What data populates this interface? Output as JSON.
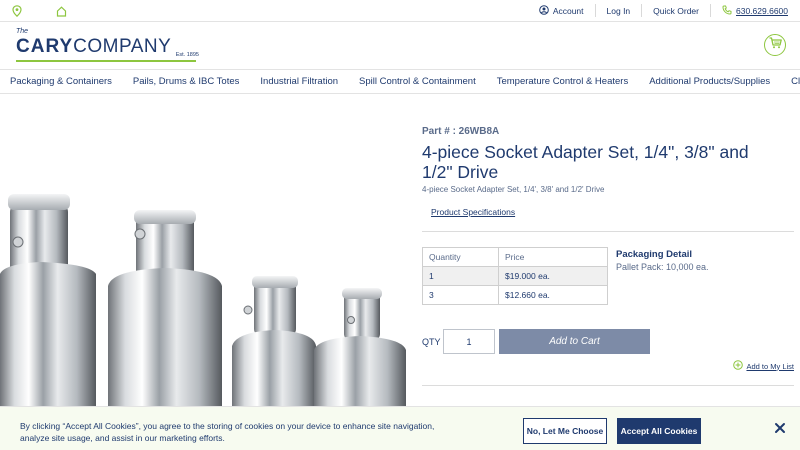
{
  "utility": {
    "account": "Account",
    "login": "Log In",
    "quick_order": "Quick Order",
    "phone": "630.629.6600"
  },
  "logo": {
    "the": "The",
    "cary": "CARY",
    "company": "COMPANY",
    "est": "Est. 1895"
  },
  "nav": {
    "items": [
      "Packaging & Containers",
      "Pails, Drums & IBC Totes",
      "Industrial Filtration",
      "Spill Control & Containment",
      "Temperature Control & Heaters",
      "Additional Products/Supplies",
      "Clearance"
    ]
  },
  "product": {
    "part": "Part # : 26WB8A",
    "title": "4-piece Socket Adapter Set, 1/4\", 3/8\" and 1/2\" Drive",
    "subtitle": "4-piece Socket Adapter Set, 1/4', 3/8' and 1/2' Drive",
    "specs_link": "Product Specifications",
    "price_table": {
      "headers": [
        "Quantity",
        "Price"
      ],
      "rows": [
        [
          "1",
          "$19.000 ea."
        ],
        [
          "3",
          "$12.660 ea."
        ]
      ]
    },
    "packaging_title": "Packaging Detail",
    "packaging_text": "Pallet Pack: 10,000 ea.",
    "qty_label": "QTY",
    "qty_value": "1",
    "add_to_cart": "Add to Cart",
    "wishlist": "Add to My List"
  },
  "cookie": {
    "text": "By clicking “Accept All Cookies”, you agree to the storing of cookies on your device to enhance site navigation, analyze site usage, and assist in our marketing efforts.",
    "reject": "No, Let Me Choose",
    "accept": "Accept All Cookies"
  },
  "colors": {
    "brand_navy": "#1f3a6e",
    "brand_green": "#8dc63f",
    "cart_button": "#7d8ba7"
  }
}
